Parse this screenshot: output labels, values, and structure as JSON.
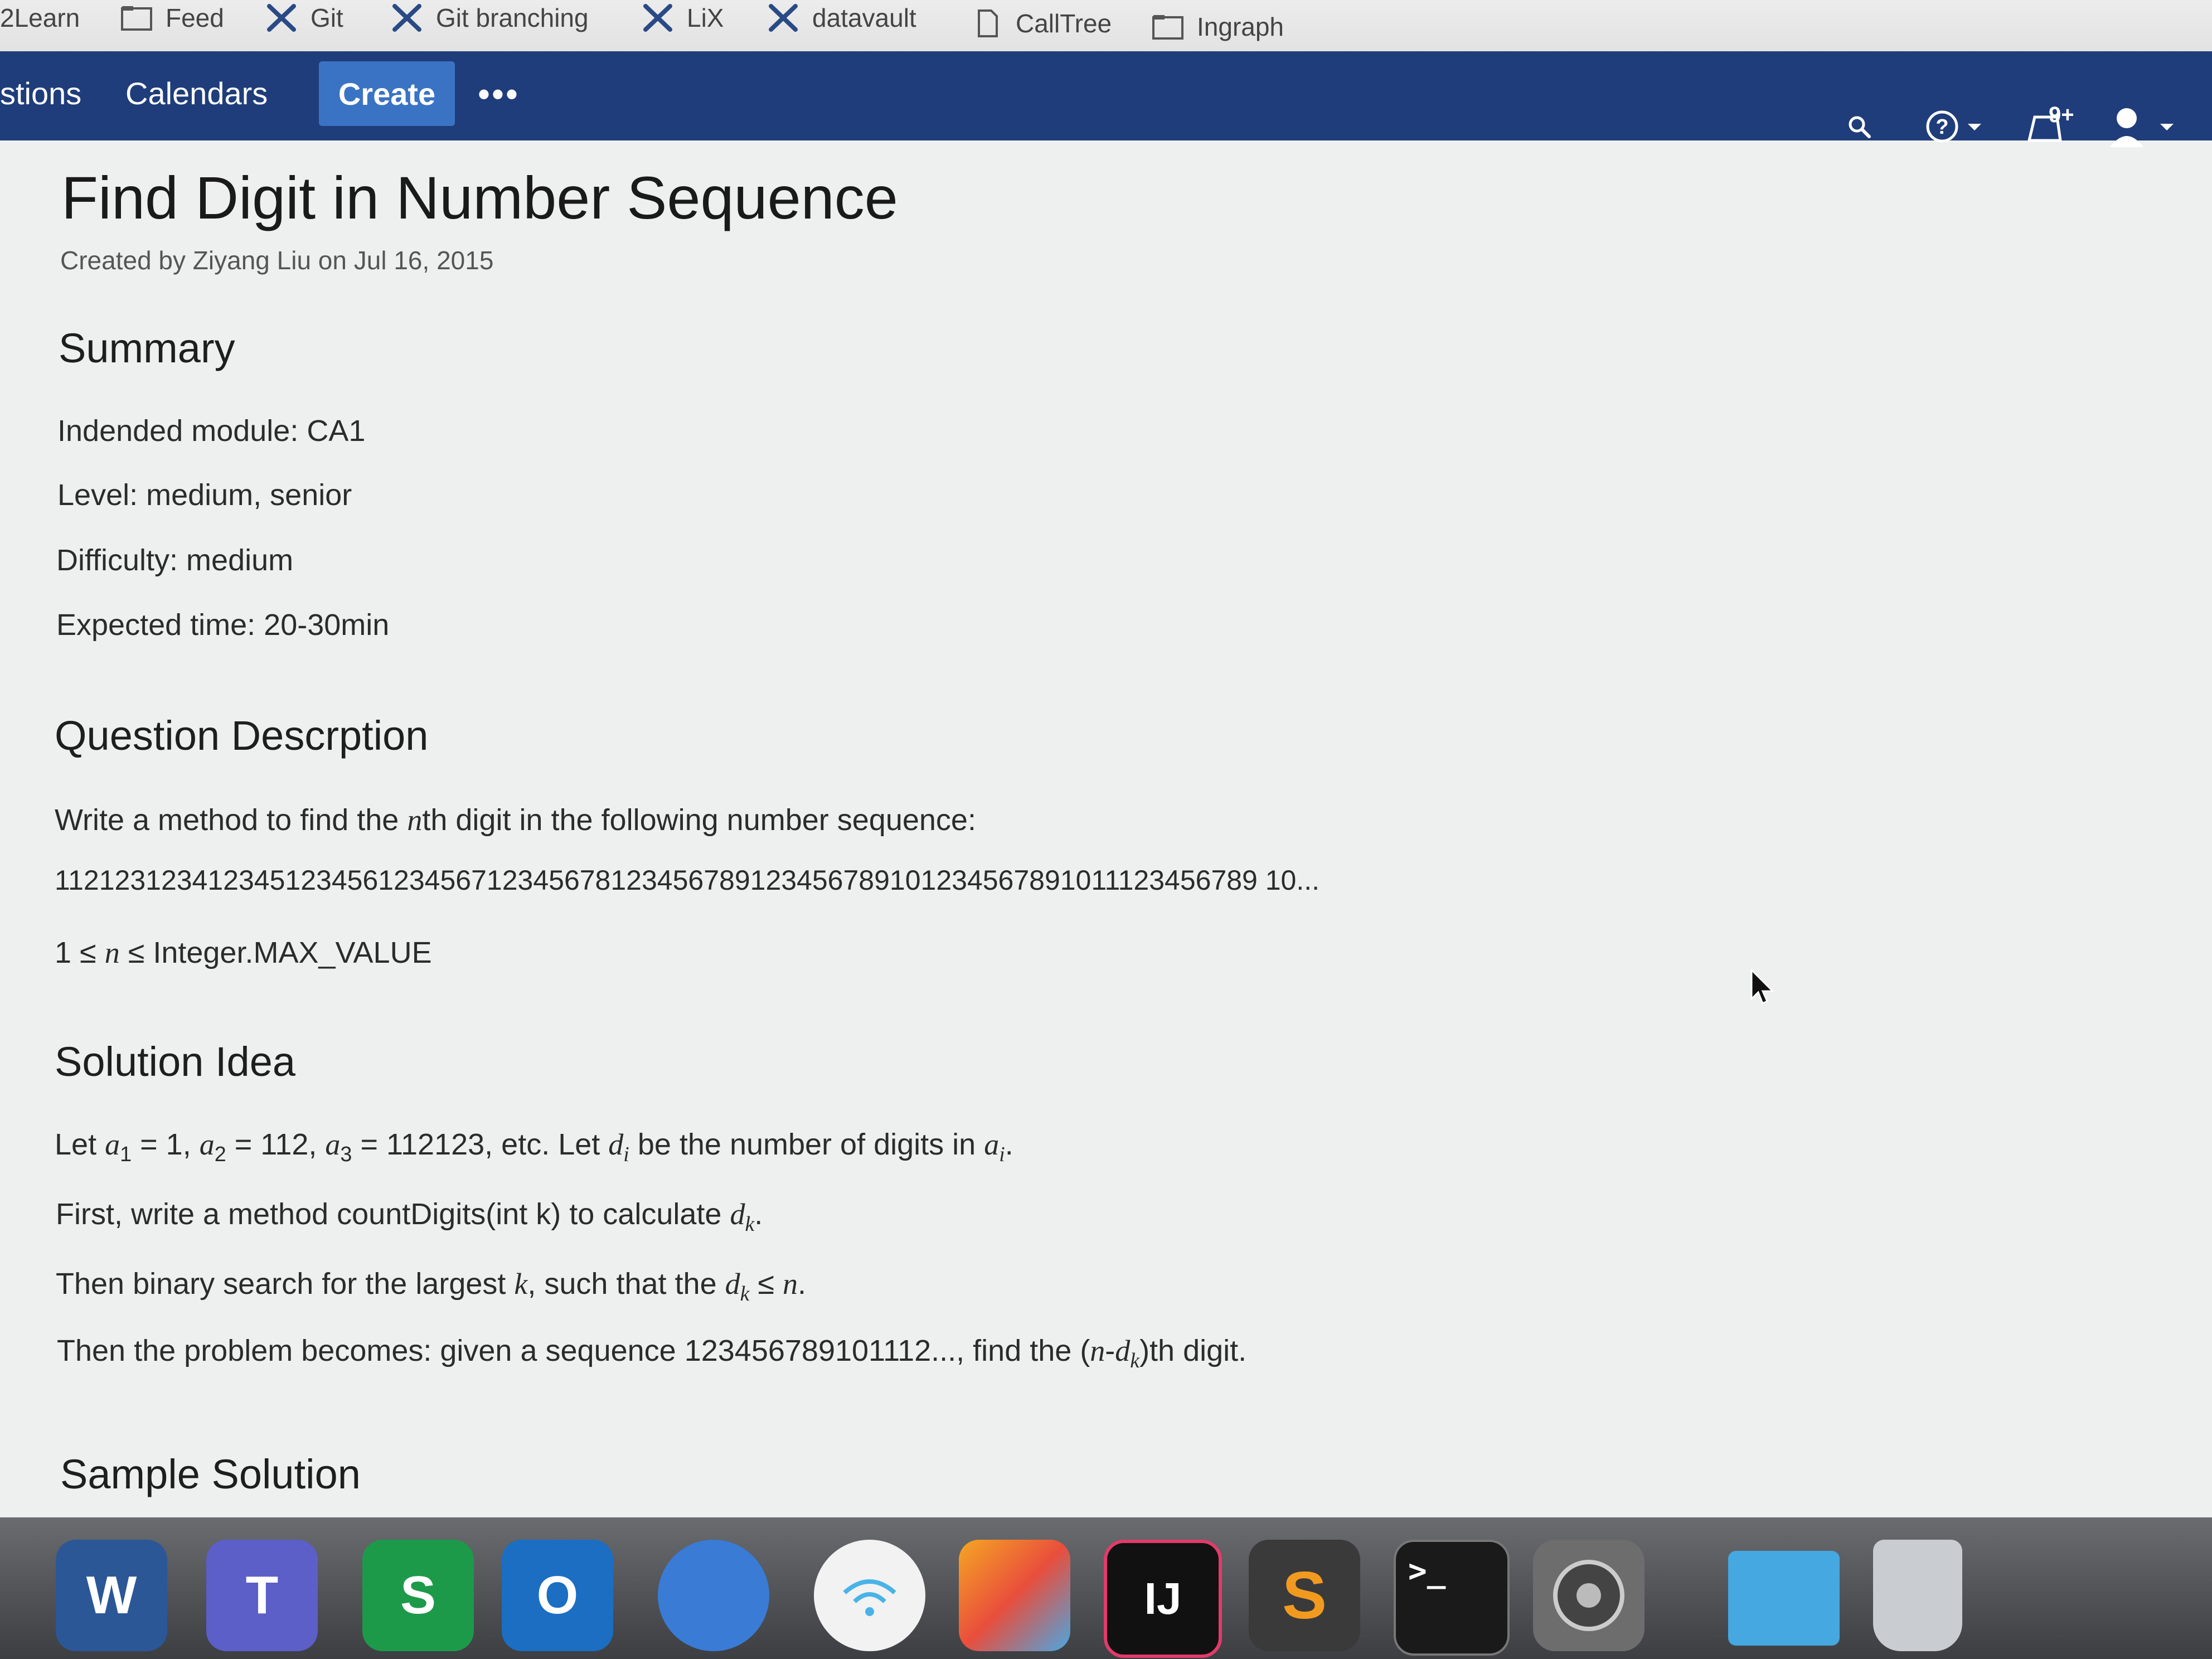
{
  "bookmarks": [
    {
      "label": "2Learn",
      "icon": "none"
    },
    {
      "label": "Feed",
      "icon": "folder-icon"
    },
    {
      "label": "Git",
      "icon": "tool-icon"
    },
    {
      "label": "Git branching",
      "icon": "tool-icon"
    },
    {
      "label": "LiX",
      "icon": "tool-icon"
    },
    {
      "label": "datavault",
      "icon": "tool-icon"
    },
    {
      "label": "CallTree",
      "icon": "page-icon"
    },
    {
      "label": "Ingraph",
      "icon": "folder-icon"
    }
  ],
  "nav": {
    "items": [
      "stions",
      "Calendars"
    ],
    "create_label": "Create",
    "more_label": "•••",
    "notifications_badge": "9+"
  },
  "page": {
    "title": "Find Digit in Number Sequence",
    "byline": "Created by Ziyang Liu on Jul 16, 2015",
    "summary_heading": "Summary",
    "summary": [
      "Indended module: CA1",
      "Level: medium, senior",
      "Difficulty: medium",
      "Expected time: 20-30min"
    ],
    "question_heading": "Question Descrption",
    "question_intro_pre": "Write a method to find the ",
    "question_intro_var": "n",
    "question_intro_post": "th digit in the following number sequence:",
    "sequence": "112123123412345123456123456712345678123456789123456789101234567891011123456789 10...",
    "constraint_pre": "1 ≤ ",
    "constraint_var": "n",
    "constraint_post": " ≤ Integer.MAX_VALUE",
    "solution_heading": "Solution Idea",
    "sol1_a": "Let ",
    "sol1_b": "= 1, ",
    "sol1_c": "= 112, ",
    "sol1_d": "= 112123, etc. Let ",
    "sol1_e": "be the number of digits in ",
    "sol2_pre": "First, write a method countDigits(int k) to calculate ",
    "sol3_pre": "Then binary search for the largest ",
    "sol3_mid": ", such that the ",
    "sol4_pre": "Then the problem becomes: given a sequence 123456789101112..., find the (",
    "sol4_post": ")th digit.",
    "sample_heading": "Sample Solution"
  },
  "dock": [
    {
      "name": "word-icon",
      "label": "W",
      "color": "#2b5797"
    },
    {
      "name": "teams-icon",
      "label": "T",
      "color": "#5b5fc7"
    },
    {
      "name": "skype-icon",
      "label": "S",
      "color": "#1c9a4a"
    },
    {
      "name": "outlook-icon",
      "label": "O",
      "color": "#1b6ec2"
    },
    {
      "name": "vpn-icon",
      "label": "",
      "color": "#3a7bd5"
    },
    {
      "name": "wifi-icon",
      "label": "",
      "color": "#f2f2f2"
    },
    {
      "name": "mosaic-icon",
      "label": "",
      "color": "#e94e3c"
    },
    {
      "name": "intellij-icon",
      "label": "IJ",
      "color": "#111111"
    },
    {
      "name": "sublime-icon",
      "label": "S",
      "color": "#3a3a3a"
    },
    {
      "name": "terminal-icon",
      "label": ">_",
      "color": "#1a1a1a"
    },
    {
      "name": "system-preferences-icon",
      "label": "",
      "color": "#6d6d6d"
    },
    {
      "name": "downloads-folder-icon",
      "label": "",
      "color": "#45a8e0"
    },
    {
      "name": "trash-icon",
      "label": "",
      "color": "#c9ccd0"
    }
  ]
}
